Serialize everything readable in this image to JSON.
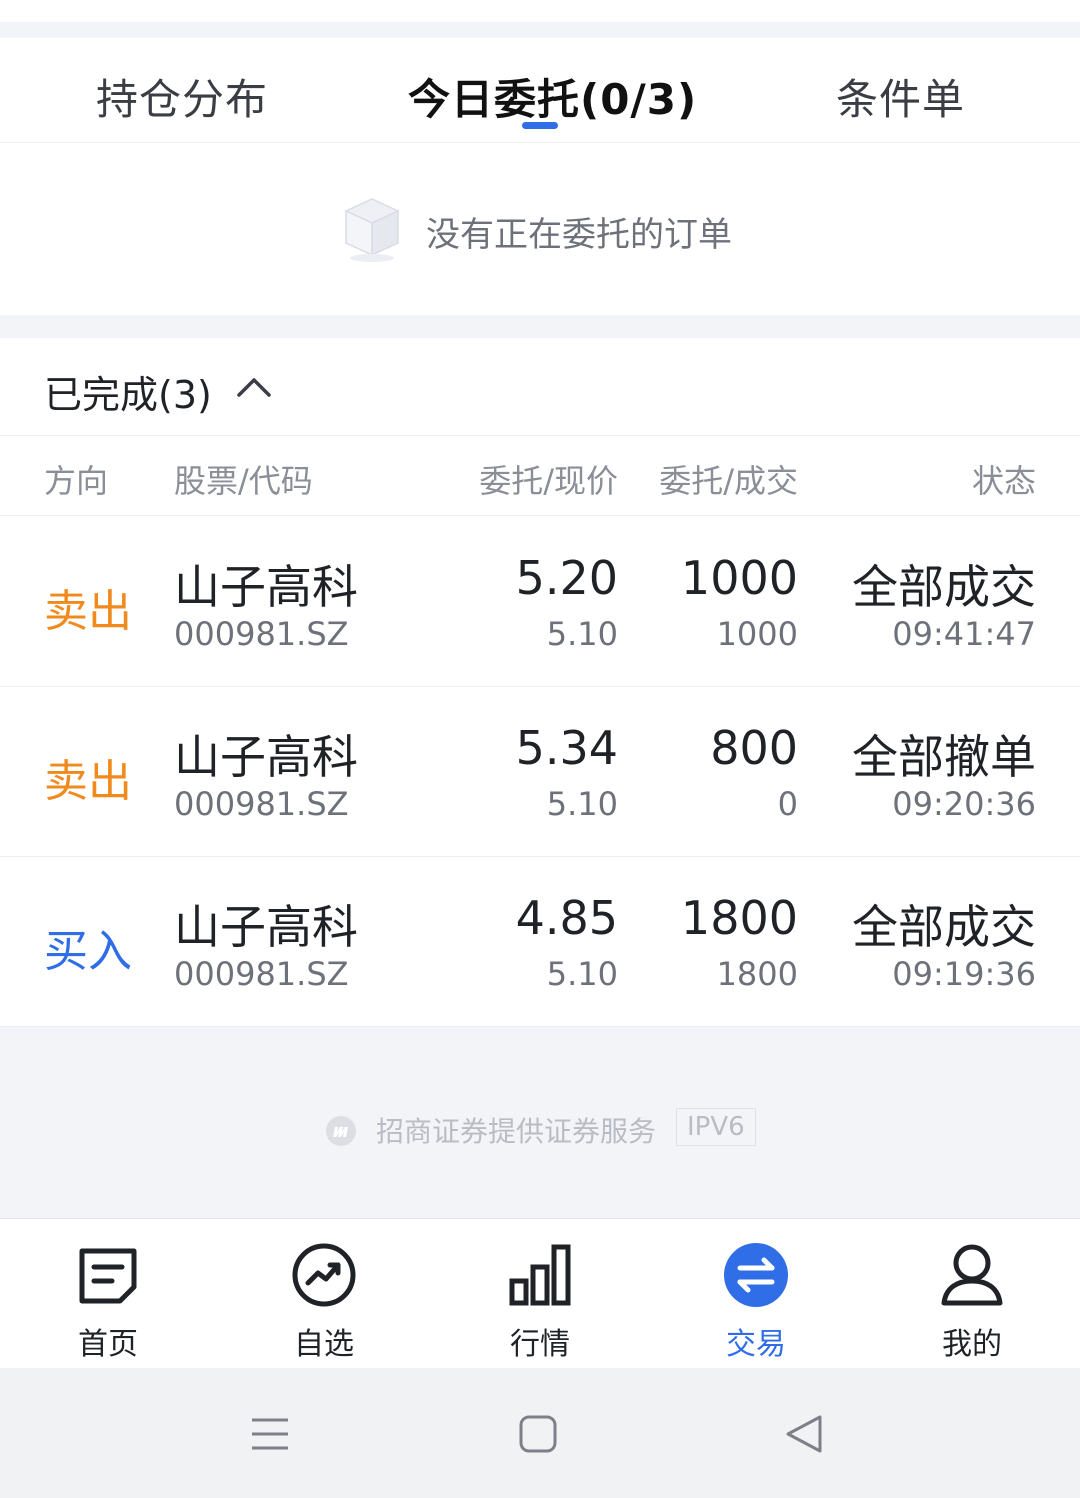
{
  "tabs": [
    {
      "label": "持仓分布"
    },
    {
      "label": "今日委托(0/3)"
    },
    {
      "label": "条件单"
    }
  ],
  "empty": {
    "message": "没有正在委托的订单"
  },
  "completed": {
    "title": "已完成(3)",
    "columns": {
      "direction": "方向",
      "stock": "股票/代码",
      "price": "委托/现价",
      "qty": "委托/成交",
      "status": "状态"
    },
    "rows": [
      {
        "direction": "卖出",
        "side": "sell",
        "name": "山子高科",
        "code": "000981.SZ",
        "order_price": "5.20",
        "current_price": "5.10",
        "order_qty": "1000",
        "filled_qty": "1000",
        "status": "全部成交",
        "time": "09:41:47"
      },
      {
        "direction": "卖出",
        "side": "sell",
        "name": "山子高科",
        "code": "000981.SZ",
        "order_price": "5.34",
        "current_price": "5.10",
        "order_qty": "800",
        "filled_qty": "0",
        "status": "全部撤单",
        "time": "09:20:36"
      },
      {
        "direction": "买入",
        "side": "buy",
        "name": "山子高科",
        "code": "000981.SZ",
        "order_price": "4.85",
        "current_price": "5.10",
        "order_qty": "1800",
        "filled_qty": "1800",
        "status": "全部成交",
        "time": "09:19:36"
      }
    ]
  },
  "footer": {
    "text": "招商证券提供证券服务",
    "badge": "IPV6"
  },
  "tabbar": [
    {
      "label": "首页",
      "icon": "home-doc-icon"
    },
    {
      "label": "自选",
      "icon": "trend-icon"
    },
    {
      "label": "行情",
      "icon": "bar-chart-icon"
    },
    {
      "label": "交易",
      "icon": "exchange-icon"
    },
    {
      "label": "我的",
      "icon": "user-icon"
    }
  ],
  "colors": {
    "accent": "#2f6ee6",
    "sell": "#f08a1c",
    "buy": "#2f6ee6"
  }
}
